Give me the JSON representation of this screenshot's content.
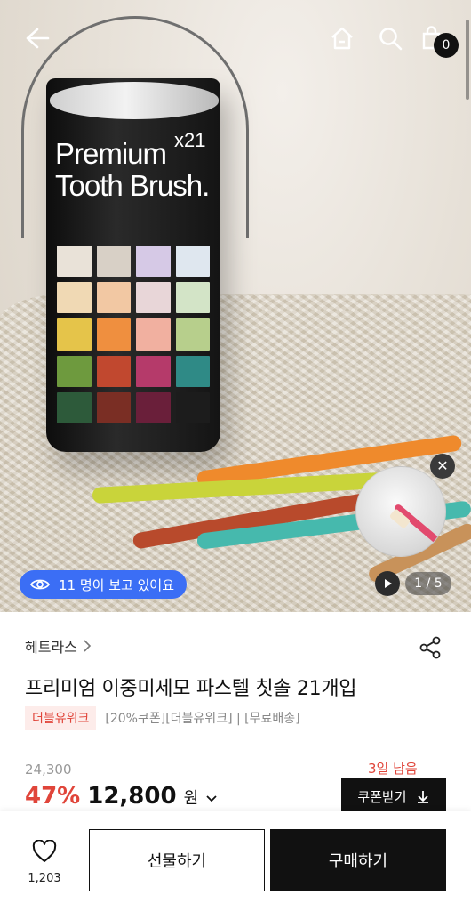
{
  "hero": {
    "image_alt": "",
    "can_title_line1": "Premium",
    "can_title_line2": "Tooth Brush.",
    "can_count": "x21",
    "viewers_text": "11 명이 보고 있어요",
    "slide_counter": "1 / 5"
  },
  "header": {
    "cart_count": "0",
    "icons": [
      "back-arrow-icon",
      "home-icon",
      "search-icon",
      "cart-icon"
    ]
  },
  "product": {
    "brand": "헤트라스",
    "title": "프리미엄 이중미세모 파스텔 칫솔 21개입",
    "badge": "더블유위크",
    "tags": "[20%쿠폰][더블유위크] | [무료배송]",
    "original_price": "24,300",
    "days_left": "3일 남음",
    "discount": "47%",
    "price": "12,800",
    "currency": "원",
    "coupon_label": "쿠폰받기"
  },
  "bottom": {
    "like_count": "1,203",
    "gift_label": "선물하기",
    "buy_label": "구매하기"
  },
  "colors": {
    "accent_red": "#e0453a",
    "viewer_blue": "#3b6ef5",
    "dark": "#111111"
  }
}
